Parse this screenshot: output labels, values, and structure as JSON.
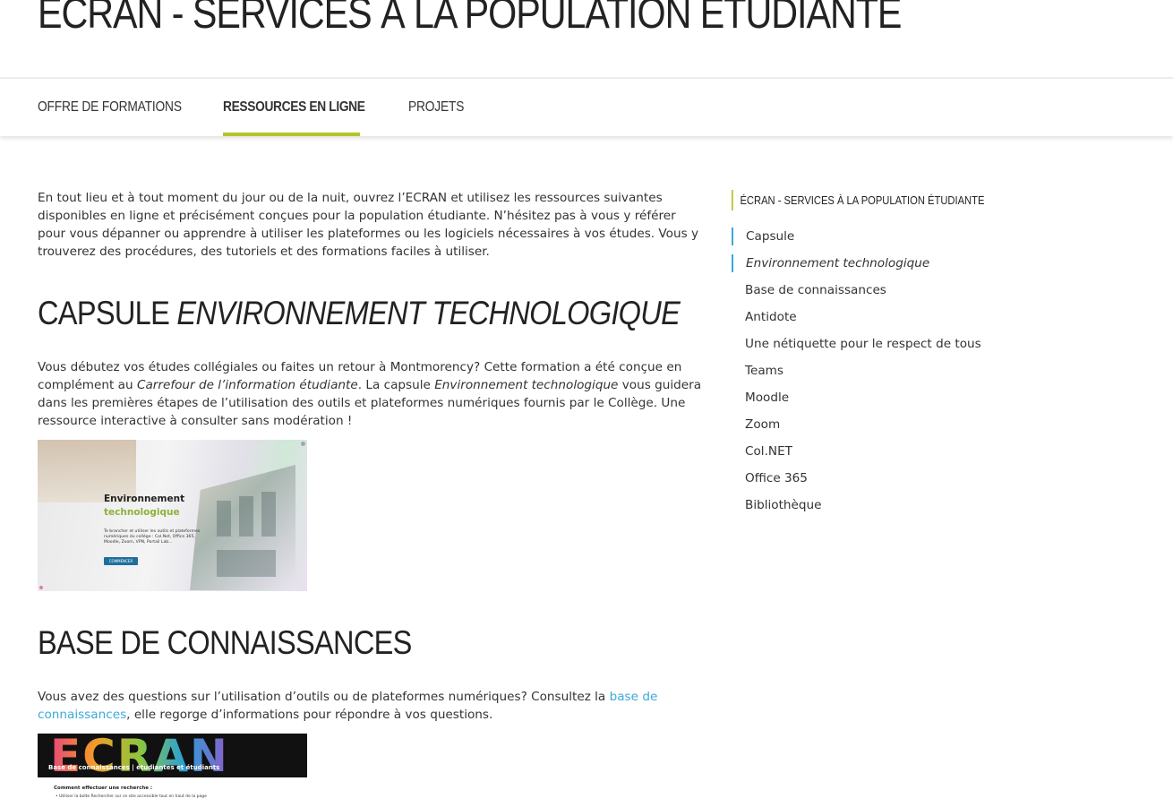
{
  "page": {
    "title": "ÉCRAN - SERVICES À LA POPULATION ÉTUDIANTE"
  },
  "tabs": [
    {
      "label": "Offre de formations",
      "active": false
    },
    {
      "label": "Ressources en ligne",
      "active": true
    },
    {
      "label": "Projets",
      "active": false
    }
  ],
  "main": {
    "intro": "En tout lieu et à tout moment du jour ou de la nuit, ouvrez l’ECRAN et utilisez les ressources suivantes disponibles en ligne et précisément conçues pour la population étudiante. N’hésitez pas à vous y référer pour vous dépanner ou apprendre à utiliser les plateformes ou les logiciels nécessaires à vos études. Vous y trouverez des procédures, des tutoriels et des formations faciles à utiliser.",
    "capsule": {
      "heading_plain": "Capsule ",
      "heading_italic": "Environnement technologique",
      "p1": "Vous débutez vos études collégiales ou faites un retour à Montmorency? Cette formation a été conçue en complément au ",
      "p1_em1": "Carrefour de l’information étudiante",
      "p1_mid": ". La capsule ",
      "p1_em2": "Environnement technologique",
      "p1_end": " vous guidera dans les premières étapes de l’utilisation des outils et plateformes numériques fournis par le Collège. Une ressource interactive à consulter sans modération !",
      "image": {
        "title": "Environnement",
        "subtitle": "technologique",
        "desc": "Te brancher et utiliser les outils et plateformes numériques du collège : Col.Net, Office 365, Moodle, Zoom, VPN, Portail Lab...",
        "button": "COMMENCER"
      }
    },
    "base": {
      "heading": "Base de connaissances",
      "p_start": "Vous avez des questions sur l’utilisation d’outils ou de plateformes numériques? Consultez la ",
      "link": "base de connaissances",
      "p_end": ", elle regorge d’informations pour répondre à vos questions.",
      "image": {
        "logo": "ECRAN",
        "label": "Base de connaissances | étudiantes et étudiants",
        "line1": "Comment effectuer une recherche :",
        "line2": "• Utiliser la boîte Rechercher sur ce site accessible tout en haut de la page"
      }
    }
  },
  "sidebar": {
    "title": "ÉCRAN - Services à la population étudiante",
    "items": [
      {
        "label": "Capsule"
      },
      {
        "label": "Environnement technologique"
      },
      {
        "label": "Base de connaissances"
      },
      {
        "label": "Antidote"
      },
      {
        "label": "Une nétiquette pour le respect de tous"
      },
      {
        "label": "Teams"
      },
      {
        "label": "Moodle"
      },
      {
        "label": "Zoom"
      },
      {
        "label": "Col.NET"
      },
      {
        "label": "Office 365"
      },
      {
        "label": "Bibliothèque"
      }
    ]
  },
  "colors": {
    "accent_green": "#b5c427",
    "link_blue": "#3ba9d9"
  }
}
